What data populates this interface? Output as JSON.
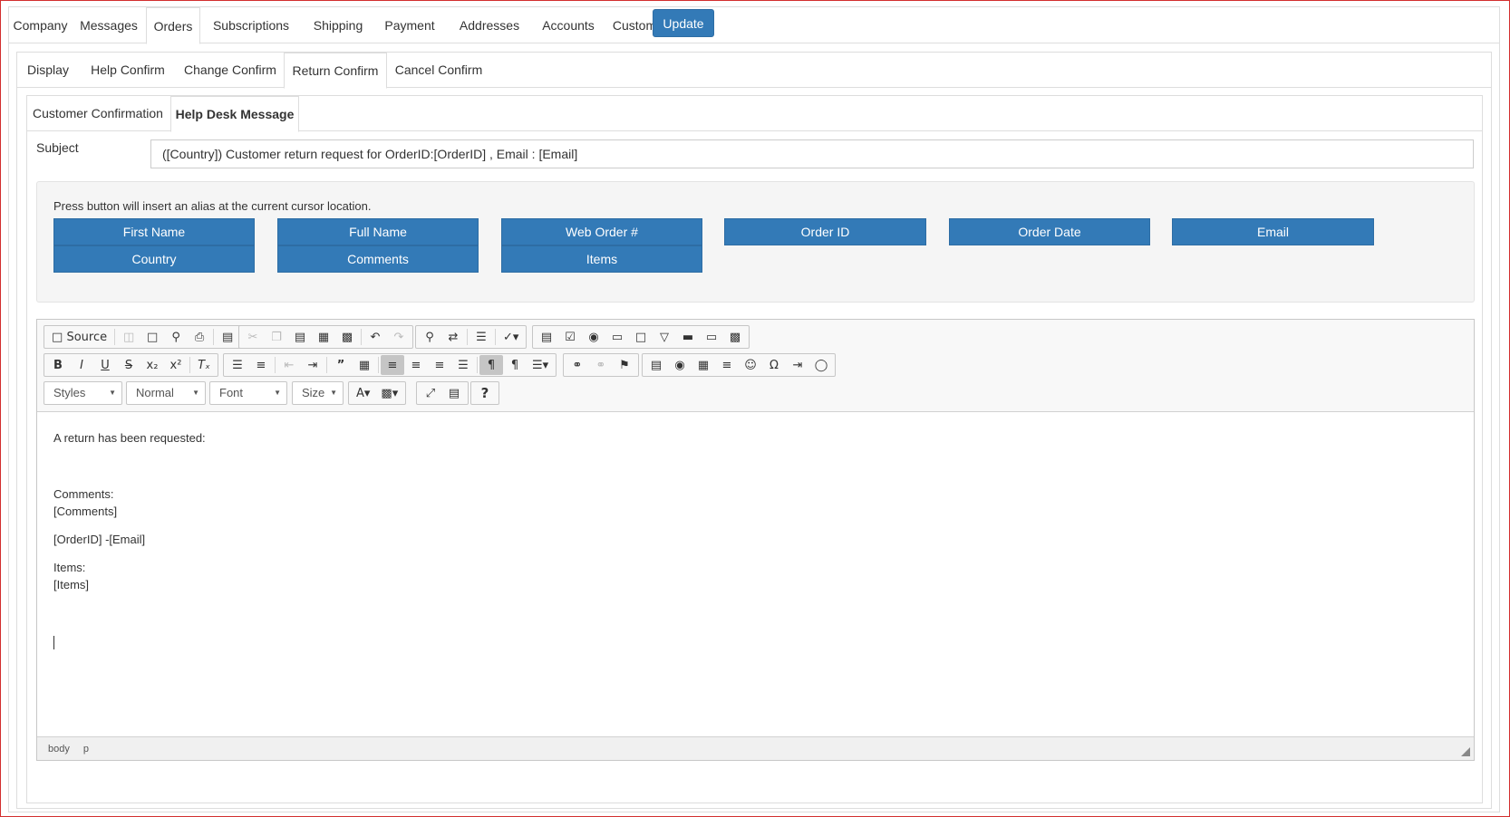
{
  "top_tabs": [
    "Company",
    "Messages",
    "Orders",
    "Subscriptions",
    "Shipping",
    "Payment",
    "Addresses",
    "Accounts",
    "Custom"
  ],
  "update_label": "Update",
  "sub_tabs": [
    "Display",
    "Help Confirm",
    "Change Confirm",
    "Return Confirm",
    "Cancel Confirm"
  ],
  "msg_tabs": [
    "Customer Confirmation",
    "Help Desk Message"
  ],
  "subject": {
    "label": "Subject",
    "value": "([Country]) Customer return request for OrderID:[OrderID] , Email : [Email]"
  },
  "alias": {
    "hint": "Press button will insert an alias at the current cursor location.",
    "buttons": [
      "First Name",
      "Full Name",
      "Web Order #",
      "Order ID",
      "Order Date",
      "Email",
      "Country",
      "Comments",
      "Items"
    ]
  },
  "toolbar": {
    "source_label": "Source",
    "styles": "Styles",
    "format": "Normal",
    "font": "Font",
    "size": "Size",
    "help": "?"
  },
  "icons": {
    "row1": [
      "source-icon",
      "save-icon",
      "new-page-icon",
      "preview-icon",
      "print-icon",
      "templates-icon",
      "cut-icon",
      "copy-icon",
      "paste-icon",
      "paste-text-icon",
      "paste-word-icon",
      "undo-icon",
      "redo-icon",
      "find-icon",
      "replace-icon",
      "select-all-icon",
      "spellcheck-icon",
      "form-icon",
      "checkbox-icon",
      "radio-icon",
      "textfield-icon",
      "textarea-icon",
      "select-icon",
      "button-icon",
      "image-button-icon",
      "hidden-field-icon"
    ],
    "row2": [
      "bold-icon",
      "italic-icon",
      "underline-icon",
      "strike-icon",
      "subscript-icon",
      "superscript-icon",
      "remove-format-icon",
      "numbered-list-icon",
      "bulleted-list-icon",
      "outdent-icon",
      "indent-icon",
      "blockquote-icon",
      "div-icon",
      "align-left-icon",
      "align-center-icon",
      "align-right-icon",
      "justify-icon",
      "ltr-icon",
      "rtl-icon",
      "language-icon",
      "link-icon",
      "unlink-icon",
      "anchor-icon",
      "image-icon",
      "flash-icon",
      "table-icon",
      "horizontal-rule-icon",
      "smiley-icon",
      "special-char-icon",
      "page-break-icon",
      "iframe-icon"
    ],
    "row3": [
      "text-color-icon",
      "bg-color-icon",
      "maximize-icon",
      "show-blocks-icon",
      "help-icon"
    ]
  },
  "body_text": {
    "line1": "A return has been requested:",
    "comments_label": "Comments:",
    "comments_value": "[Comments]",
    "order_line": "[OrderID] -[Email]",
    "items_label": "Items:",
    "items_value": "[Items]"
  },
  "path": [
    "body",
    "p"
  ],
  "colors": {
    "primary": "#337ab7",
    "frame_border": "#d32f2f"
  }
}
